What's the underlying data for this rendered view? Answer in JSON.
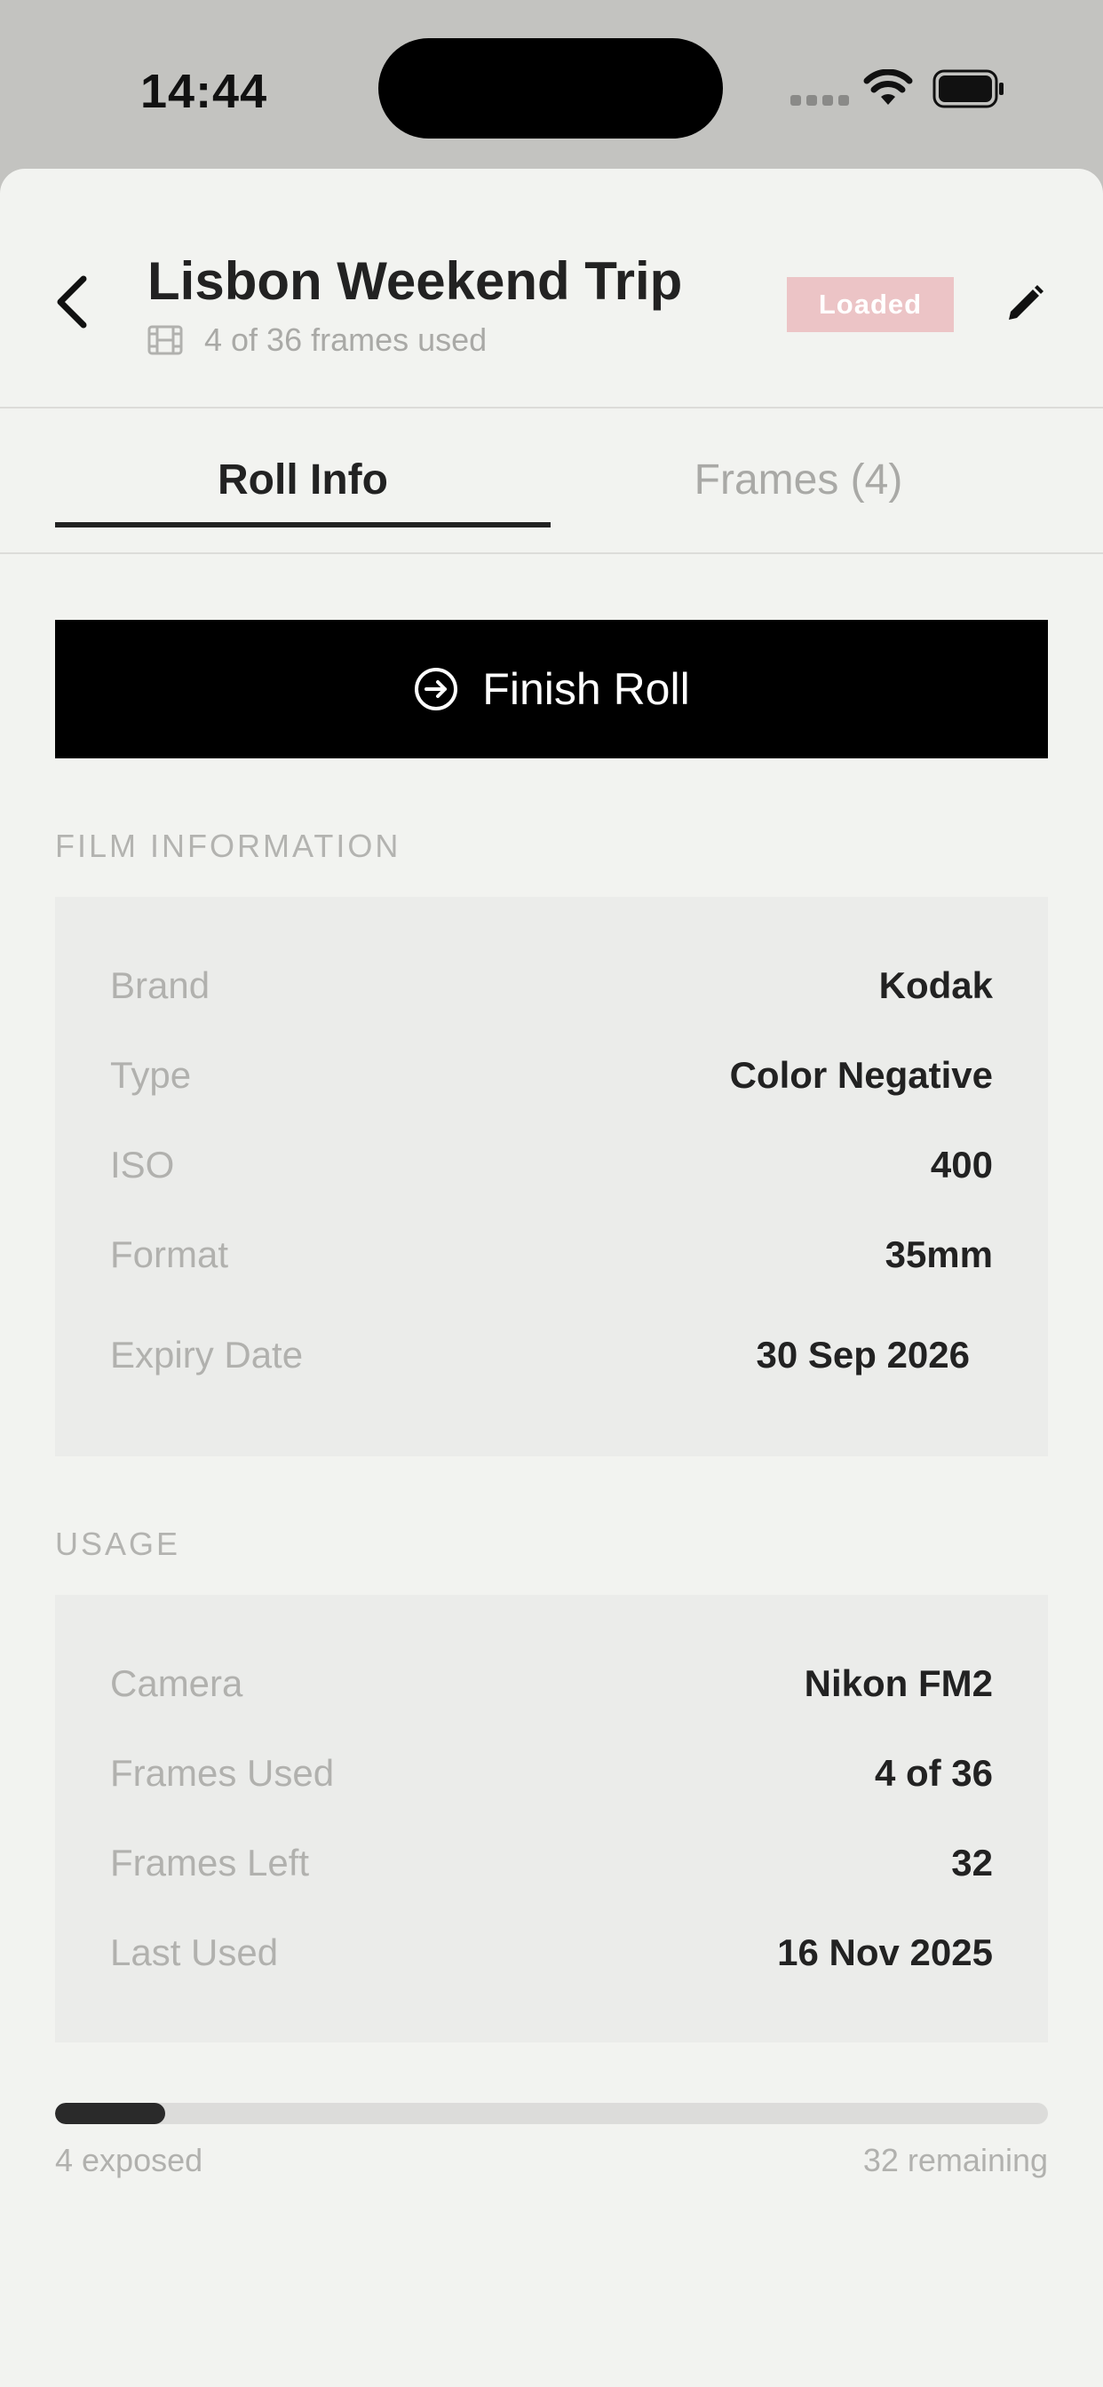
{
  "status_bar": {
    "time": "14:44"
  },
  "header": {
    "title": "Lisbon Weekend Trip",
    "subtitle": "4 of 36 frames used",
    "badge": "Loaded",
    "badge_color": "#ecc4c6"
  },
  "tabs": [
    {
      "label": "Roll Info",
      "active": true
    },
    {
      "label": "Frames (4)",
      "active": false
    }
  ],
  "finish_button": {
    "label": "Finish Roll",
    "icon": "arrow-right-circle-icon"
  },
  "film_information": {
    "heading": "FILM INFORMATION",
    "rows": [
      {
        "label": "Brand",
        "value": "Kodak"
      },
      {
        "label": "Type",
        "value": "Color Negative"
      },
      {
        "label": "ISO",
        "value": "400"
      },
      {
        "label": "Format",
        "value": "35mm"
      },
      {
        "label": "Expiry Date",
        "value": "30 Sep 2026"
      }
    ]
  },
  "usage": {
    "heading": "USAGE",
    "rows": [
      {
        "label": "Camera",
        "value": "Nikon FM2"
      },
      {
        "label": "Frames Used",
        "value": "4 of 36"
      },
      {
        "label": "Frames Left",
        "value": "32"
      },
      {
        "label": "Last Used",
        "value": "16 Nov 2025"
      }
    ]
  },
  "progress": {
    "fraction": 0.111,
    "left_label": "4 exposed",
    "right_label": "32 remaining"
  }
}
